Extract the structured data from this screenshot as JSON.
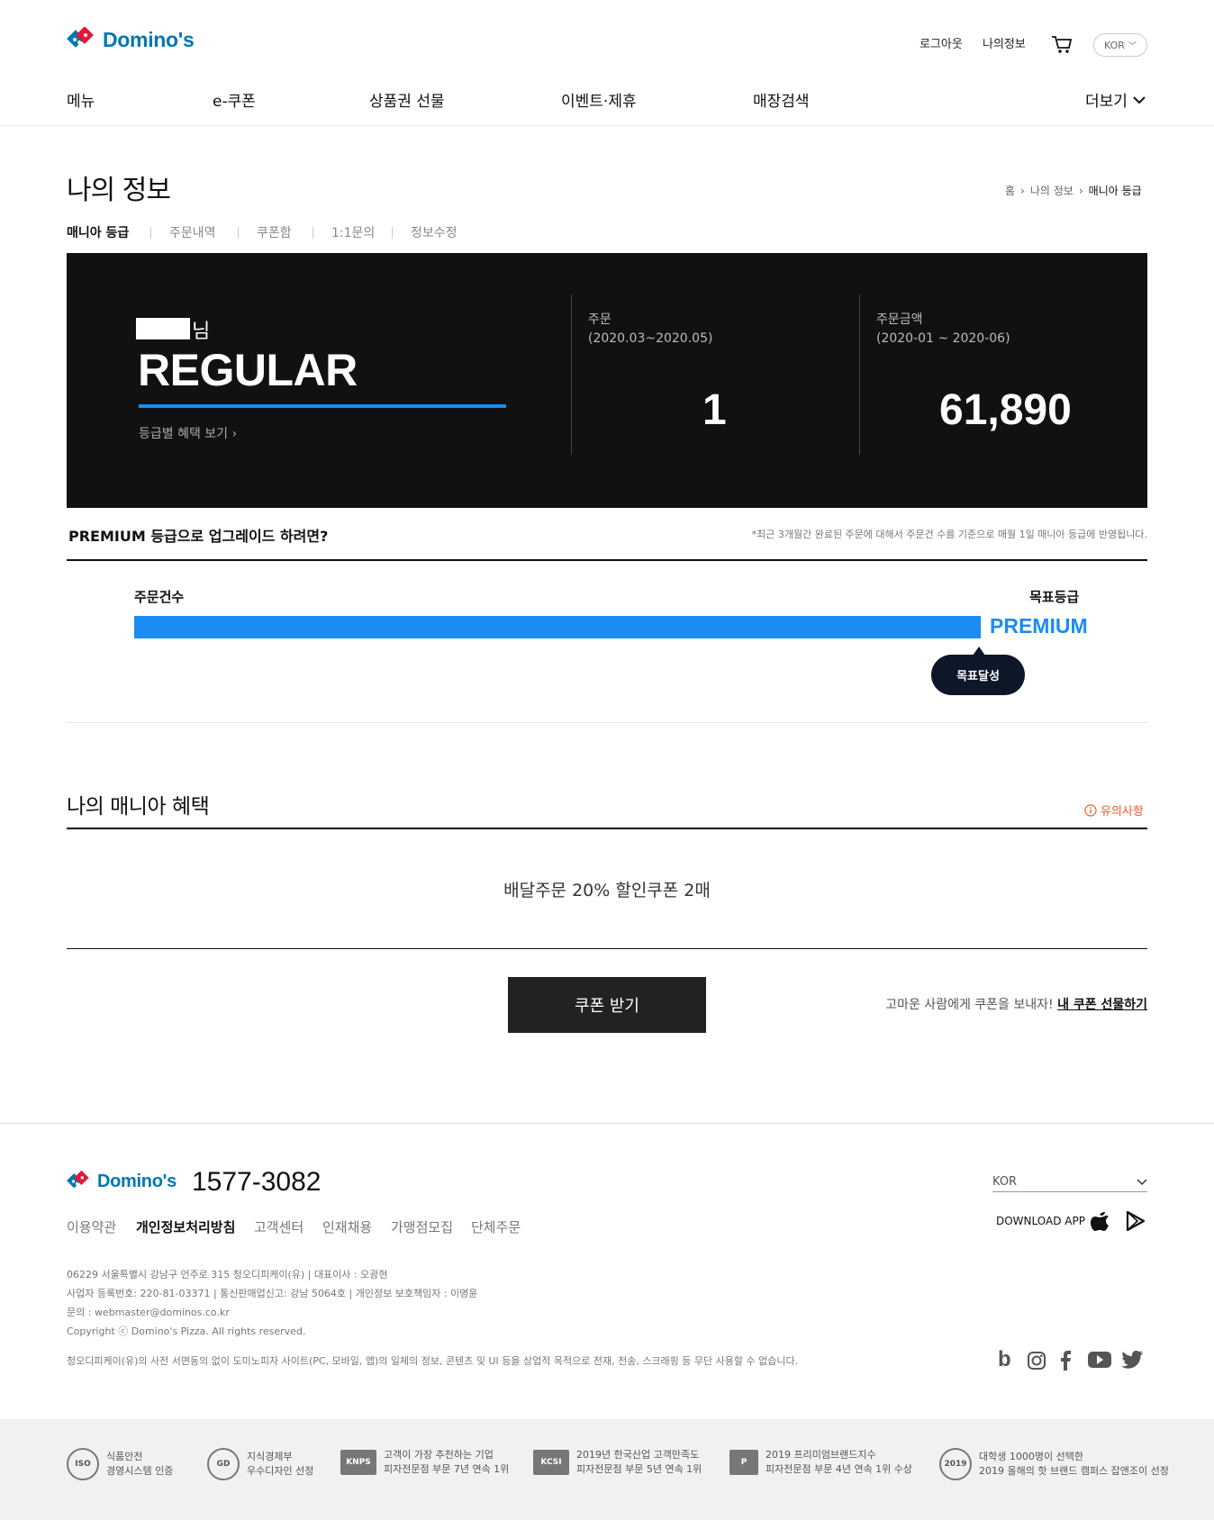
{
  "header": {
    "logo_text": "Domino's",
    "util": {
      "logout": "로그아웃",
      "myinfo": "나의정보",
      "lang": "KOR"
    },
    "gnb": [
      "메뉴",
      "e-쿠폰",
      "상품권 선물",
      "이벤트·제휴",
      "매장검색"
    ],
    "more": "더보기"
  },
  "page": {
    "title": "나의 정보",
    "breadcrumb": [
      "홈",
      "나의 정보",
      "매니아 등급"
    ],
    "tabs": [
      "매니아 등급",
      "주문내역",
      "쿠폰함",
      "1:1문의",
      "정보수정"
    ]
  },
  "grade_panel": {
    "name_suffix": "님",
    "grade": "REGULAR",
    "benefit_link": "등급별 혜택 보기 ›",
    "orders": {
      "label": "주문",
      "period": "(2020.03~2020.05)",
      "value": "1"
    },
    "amount": {
      "label": "주문금액",
      "period": "(2020-01 ~ 2020-06)",
      "value": "61,890"
    }
  },
  "upgrade": {
    "title": "PREMIUM 등급으로 업그레이드 하려면?",
    "note": "*최근 3개월간 완료된 주문에 대해서 주문건 수를 기준으로 매월 1일 매니아 등급에 반영됩니다.",
    "count_label": "주문건수",
    "target_label": "목표등급",
    "target_grade": "PREMIUM",
    "progress_fraction": 1.0,
    "bubble": "목표달성"
  },
  "mania": {
    "title": "나의 매니아 혜택",
    "notice": "유의사항",
    "benefit": "배달주문 20% 할인쿠폰 2매",
    "coupon_button": "쿠폰 받기",
    "gift_text": "고마운 사람에게 쿠폰을 보내자!",
    "gift_link": "내 쿠폰 선물하기"
  },
  "footer": {
    "logo_text": "Domino's",
    "phone": "1577-3082",
    "links": [
      "이용약관",
      "개인정보처리방침",
      "고객센터",
      "인재채용",
      "가맹점모집",
      "단체주문"
    ],
    "info": [
      "06229 서울특별시 강남구 언주로 315 청오디피케이(유) | 대표이사 : 오광현",
      "사업자 등록번호: 220-81-03371 | 통신판매업신고: 강남 5064호 | 개인정보 보호책임자 : 이명윤",
      "문의 : webmaster@dominos.co.kr",
      "Copyright ⓒ Domino's Pizza. All rights reserved.",
      "청오디피케이(유)의 사전 서면동의 없이 도미노피자 사이트(PC, 모바일, 앱)의 일체의 정보, 콘텐츠 및 UI 등을 상업적 목적으로 전재, 전송, 스크래핑 등 무단 사용할 수 없습니다."
    ],
    "lang": "KOR",
    "download": "DOWNLOAD APP",
    "certs": [
      {
        "icon": "ISO",
        "line1": "식품안전",
        "line2": "경영시스템 인증"
      },
      {
        "icon": "GD",
        "line1": "지식경제부",
        "line2": "우수디자인 선정"
      },
      {
        "icon": "KNPS",
        "line1": "고객이 가장 추천하는 기업",
        "line2": "피자전문점 부문 7년 연속 1위"
      },
      {
        "icon": "KCSI",
        "line1": "2019년 한국산업 고객만족도",
        "line2": "피자전문점 부문 5년 연속 1위"
      },
      {
        "icon": "P",
        "line1": "2019 프리미엄브랜드지수",
        "line2": "피자전문점 부문 4년 연속 1위 수상"
      },
      {
        "icon": "2019",
        "line1": "대학생 1000명이 선택한",
        "line2": "2019 올해의 핫 브랜드 캠퍼스 잡앤조이 선정"
      }
    ]
  }
}
